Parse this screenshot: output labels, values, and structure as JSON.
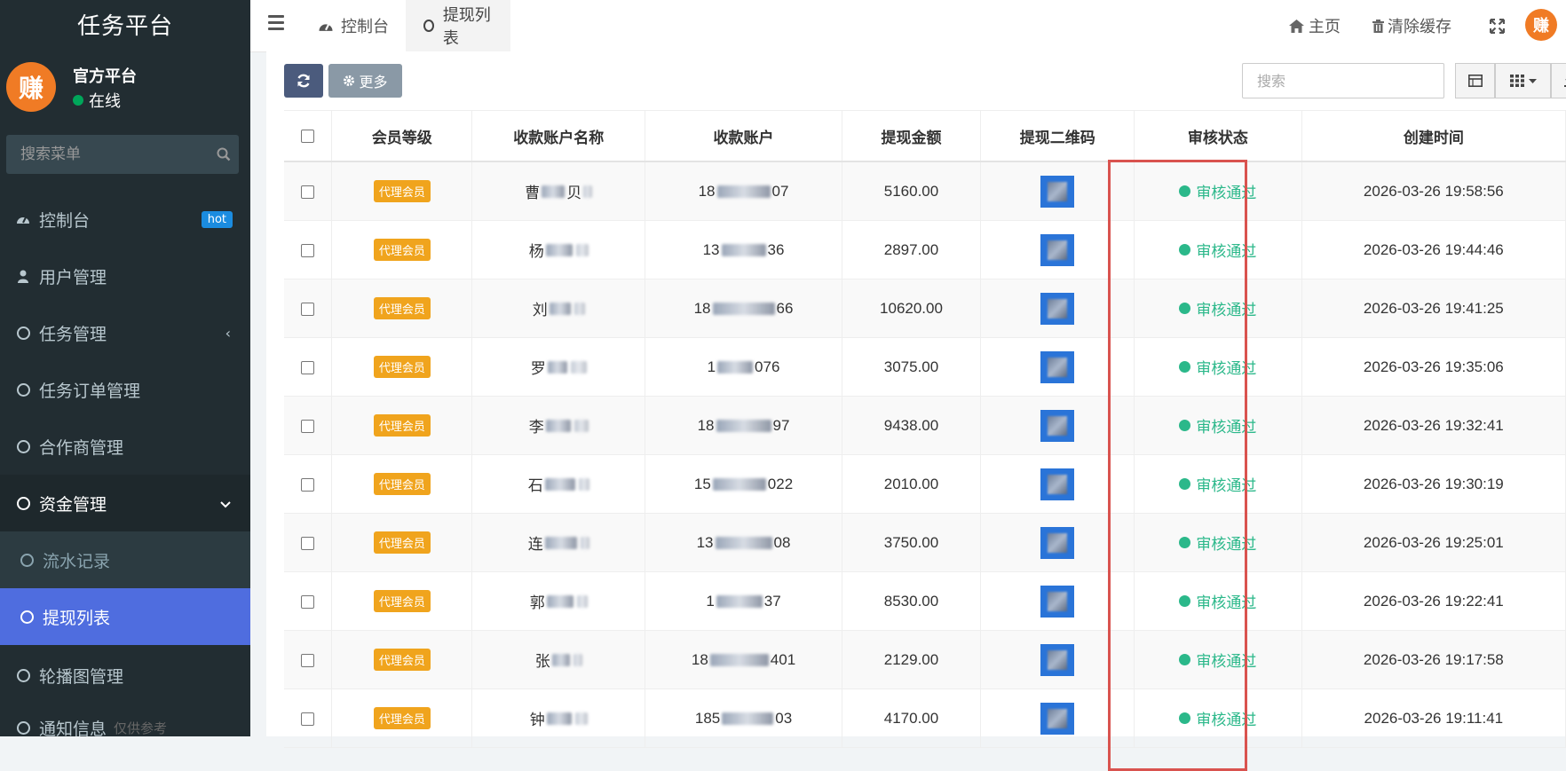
{
  "sidebar": {
    "brand": "任务平台",
    "user": {
      "name": "官方平台",
      "status": "在线",
      "avatar_text": "赚"
    },
    "search_placeholder": "搜索菜单",
    "items": [
      {
        "label": "控制台",
        "badge": "hot"
      },
      {
        "label": "用户管理"
      },
      {
        "label": "任务管理"
      },
      {
        "label": "任务订单管理"
      },
      {
        "label": "合作商管理"
      },
      {
        "label": "资金管理"
      },
      {
        "label": "流水记录"
      },
      {
        "label": "提现列表"
      },
      {
        "label": "轮播图管理"
      },
      {
        "label": "通知信息",
        "hint": "仅供参考"
      }
    ]
  },
  "navbar": {
    "tabs": [
      {
        "label": "控制台"
      },
      {
        "label": "提现列表"
      }
    ],
    "home_label": "主页",
    "clear_cache_label": "清除缓存",
    "avatar_text": "赚"
  },
  "toolbar": {
    "more_label": "更多",
    "search_placeholder": "搜索"
  },
  "table": {
    "columns": [
      "会员等级",
      "收款账户名称",
      "收款账户",
      "提现金额",
      "提现二维码",
      "审核状态",
      "创建时间"
    ],
    "rows": [
      {
        "level": "代理会员",
        "name_prefix": "曹",
        "name_suffix": "贝",
        "account_prefix": "18",
        "account_suffix": "07",
        "amount": "5160.00",
        "status": "审核通过",
        "created": "2026-03-26 19:58:56"
      },
      {
        "level": "代理会员",
        "name_prefix": "杨",
        "name_suffix": "",
        "account_prefix": "13",
        "account_suffix": "36",
        "amount": "2897.00",
        "status": "审核通过",
        "created": "2026-03-26 19:44:46"
      },
      {
        "level": "代理会员",
        "name_prefix": "刘",
        "name_suffix": "",
        "account_prefix": "18",
        "account_suffix": "66",
        "amount": "10620.00",
        "status": "审核通过",
        "created": "2026-03-26 19:41:25"
      },
      {
        "level": "代理会员",
        "name_prefix": "罗",
        "name_suffix": "",
        "account_prefix": "1",
        "account_suffix": "076",
        "amount": "3075.00",
        "status": "审核通过",
        "created": "2026-03-26 19:35:06"
      },
      {
        "level": "代理会员",
        "name_prefix": "李",
        "name_suffix": "",
        "account_prefix": "18",
        "account_suffix": "97",
        "amount": "9438.00",
        "status": "审核通过",
        "created": "2026-03-26 19:32:41"
      },
      {
        "level": "代理会员",
        "name_prefix": "石",
        "name_suffix": "",
        "account_prefix": "15",
        "account_suffix": "022",
        "amount": "2010.00",
        "status": "审核通过",
        "created": "2026-03-26 19:30:19"
      },
      {
        "level": "代理会员",
        "name_prefix": "连",
        "name_suffix": "",
        "account_prefix": "13",
        "account_suffix": "08",
        "amount": "3750.00",
        "status": "审核通过",
        "created": "2026-03-26 19:25:01"
      },
      {
        "level": "代理会员",
        "name_prefix": "郭",
        "name_suffix": "",
        "account_prefix": "1",
        "account_suffix": "37",
        "amount": "8530.00",
        "status": "审核通过",
        "created": "2026-03-26 19:22:41"
      },
      {
        "level": "代理会员",
        "name_prefix": "张",
        "name_suffix": "",
        "account_prefix": "18",
        "account_suffix": "401",
        "amount": "2129.00",
        "status": "审核通过",
        "created": "2026-03-26 19:17:58"
      },
      {
        "level": "代理会员",
        "name_prefix": "钟",
        "name_suffix": "",
        "account_prefix": "185",
        "account_suffix": "03",
        "amount": "4170.00",
        "status": "审核通过",
        "created": "2026-03-26 19:11:41"
      }
    ]
  },
  "colors": {
    "sidebar_bg": "#222d32",
    "active_menu": "#4f6ddf",
    "level_tag": "#f0a41d",
    "status_ok": "#2bb88a",
    "highlight": "#d9534f",
    "avatar": "#f07b25"
  }
}
